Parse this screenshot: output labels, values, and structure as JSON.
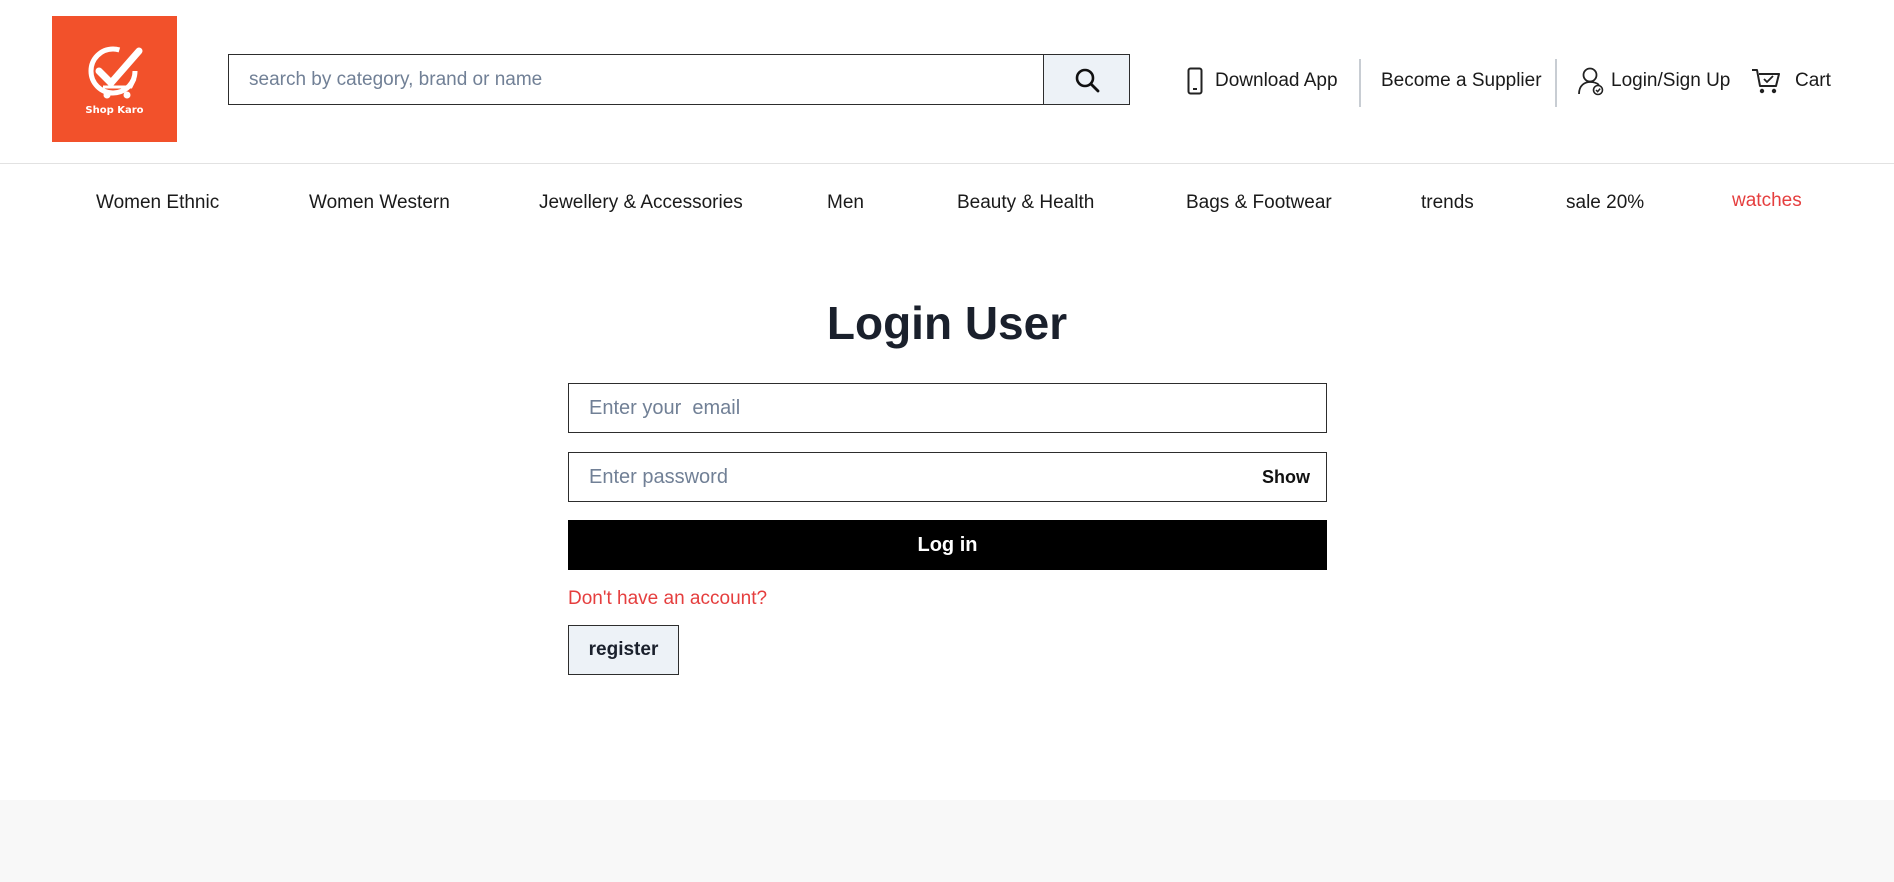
{
  "brand": {
    "name": "Shop Karo",
    "accent": "#f2512b"
  },
  "search": {
    "placeholder": "search by category, brand or name",
    "icon": "search-icon"
  },
  "header_links": {
    "download_app": "Download App",
    "become_supplier": "Become a Supplier",
    "login_signup": "Login/Sign Up",
    "cart": "Cart"
  },
  "categories": [
    "Women Ethnic",
    "Women Western",
    "Jewellery & Accessories",
    "Men",
    "Beauty & Health",
    "Bags & Footwear",
    "trends",
    "sale 20%",
    "watches"
  ],
  "form": {
    "title": "Login User",
    "email_placeholder": "Enter your  email",
    "password_placeholder": "Enter password",
    "show_label": "Show",
    "login_label": "Log in",
    "no_account_text": "Don't have an account?",
    "register_label": "register"
  },
  "colors": {
    "highlight": "#e53e3e",
    "button_dark": "#000000",
    "button_light": "#edf2f7"
  }
}
